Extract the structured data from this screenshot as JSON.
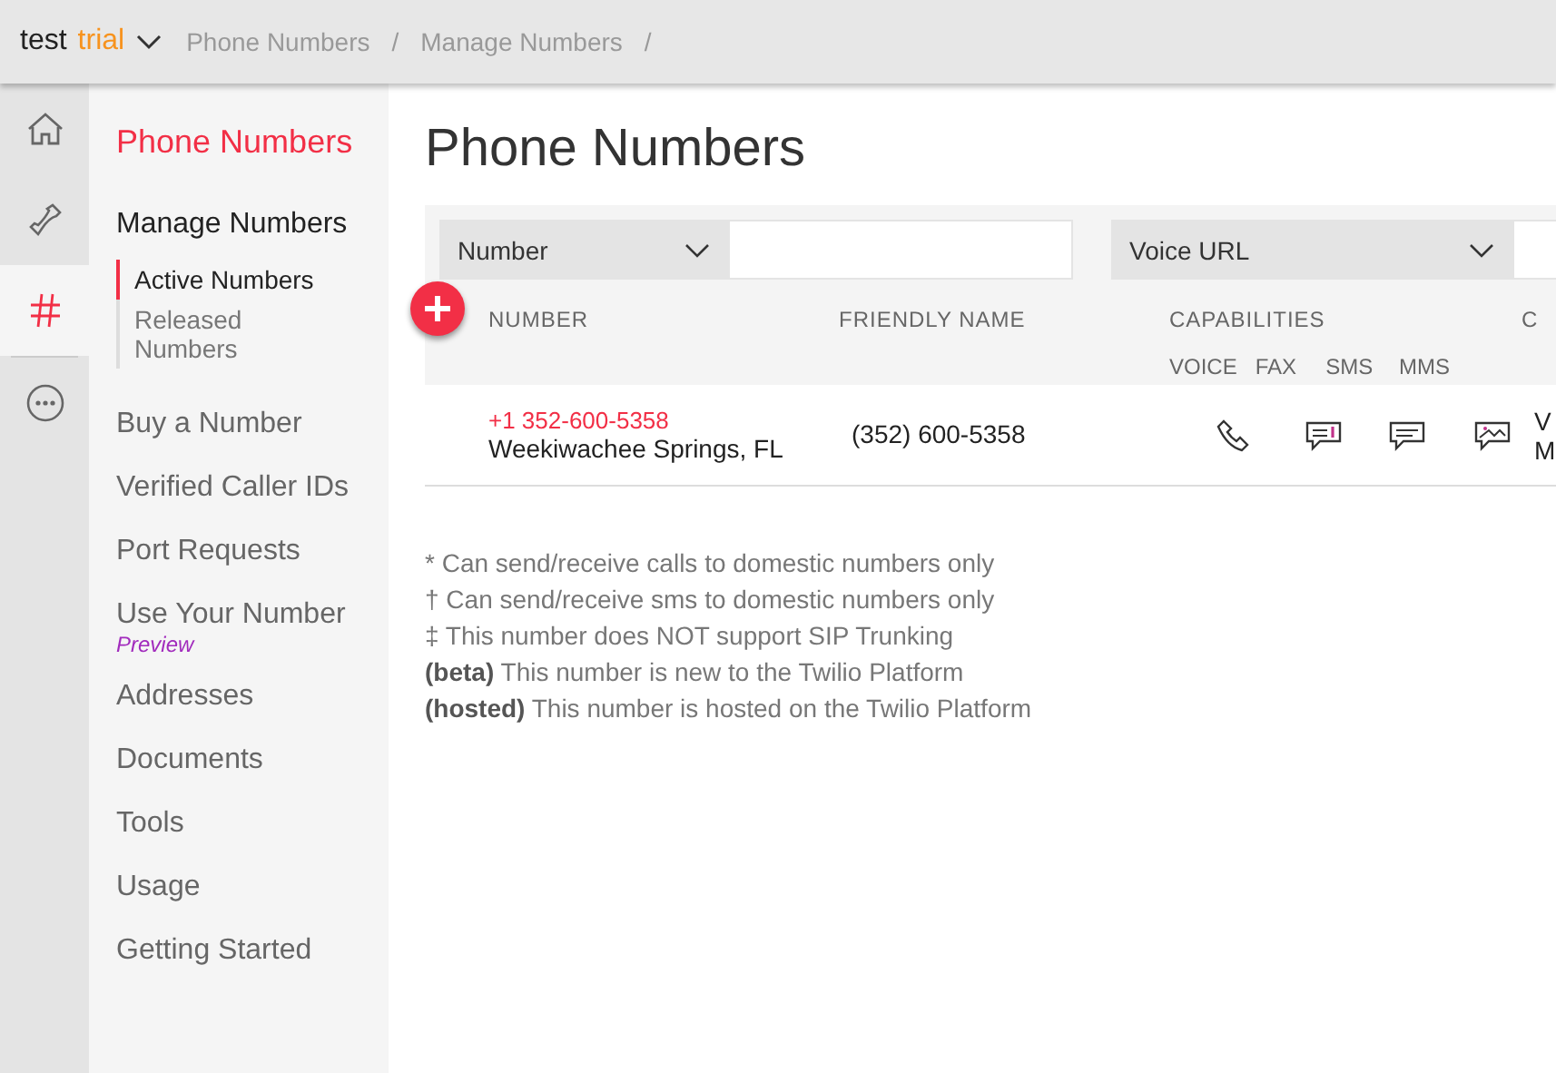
{
  "account": {
    "name": "test",
    "plan": "trial"
  },
  "breadcrumbs": [
    "Phone Numbers",
    "/",
    "Manage Numbers",
    "/"
  ],
  "rail": [
    {
      "kind": "home",
      "selected": false
    },
    {
      "kind": "phone",
      "selected": false
    },
    {
      "kind": "hash",
      "selected": true
    },
    {
      "kind": "more",
      "selected": false
    }
  ],
  "sidebar": {
    "title": "Phone Numbers",
    "section": "Manage Numbers",
    "subitems": [
      {
        "label": "Active Numbers",
        "selected": true
      },
      {
        "label": "Released Numbers",
        "selected": false
      }
    ],
    "items": [
      {
        "label": "Buy a Number"
      },
      {
        "label": "Verified Caller IDs"
      },
      {
        "label": "Port Requests"
      },
      {
        "label": "Use Your Number",
        "badge": "Preview"
      },
      {
        "label": "Addresses"
      },
      {
        "label": "Documents"
      },
      {
        "label": "Tools"
      },
      {
        "label": "Usage"
      },
      {
        "label": "Getting Started"
      }
    ]
  },
  "page_title": "Phone Numbers",
  "filters": [
    {
      "field": "Number"
    },
    {
      "field": "Voice URL"
    }
  ],
  "table": {
    "columns": [
      "NUMBER",
      "FRIENDLY NAME",
      "CAPABILITIES",
      "C"
    ],
    "capabilities": [
      "VOICE",
      "FAX",
      "SMS",
      "MMS"
    ],
    "rows": [
      {
        "number": "+1 352-600-5358",
        "location": "Weekiwachee Springs, FL",
        "friendly_name": "(352) 600-5358",
        "capabilities": [
          {
            "kind": "voice"
          },
          {
            "kind": "fax"
          },
          {
            "kind": "sms"
          },
          {
            "kind": "mms"
          }
        ],
        "column_4": [
          "V",
          "M"
        ]
      }
    ]
  },
  "footnotes": [
    "* Can send/receive calls to domestic numbers only",
    "† Can send/receive sms to domestic numbers only",
    "‡ This number does NOT support SIP Trunking",
    "**(beta)** This number is new to the Twilio Platform",
    "**(hosted)** This number is hosted on the Twilio Platform"
  ]
}
